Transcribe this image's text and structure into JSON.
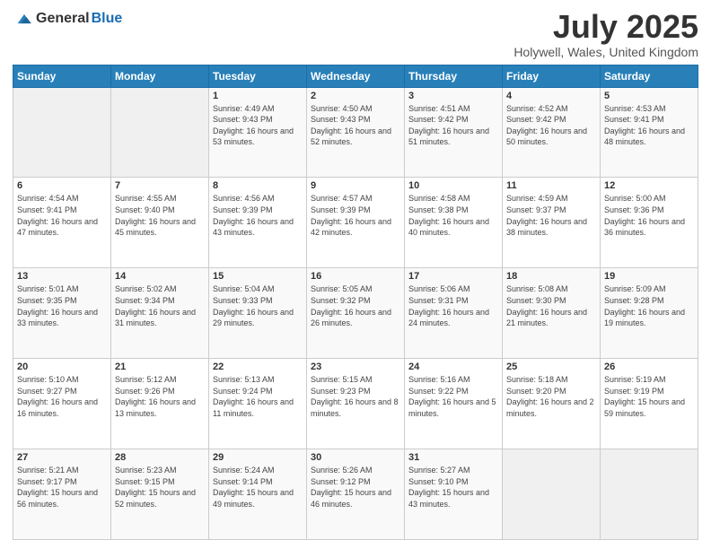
{
  "logo": {
    "general": "General",
    "blue": "Blue"
  },
  "header": {
    "month": "July 2025",
    "location": "Holywell, Wales, United Kingdom"
  },
  "days_of_week": [
    "Sunday",
    "Monday",
    "Tuesday",
    "Wednesday",
    "Thursday",
    "Friday",
    "Saturday"
  ],
  "weeks": [
    [
      {
        "day": "",
        "sunrise": "",
        "sunset": "",
        "daylight": ""
      },
      {
        "day": "",
        "sunrise": "",
        "sunset": "",
        "daylight": ""
      },
      {
        "day": "1",
        "sunrise": "Sunrise: 4:49 AM",
        "sunset": "Sunset: 9:43 PM",
        "daylight": "Daylight: 16 hours and 53 minutes."
      },
      {
        "day": "2",
        "sunrise": "Sunrise: 4:50 AM",
        "sunset": "Sunset: 9:43 PM",
        "daylight": "Daylight: 16 hours and 52 minutes."
      },
      {
        "day": "3",
        "sunrise": "Sunrise: 4:51 AM",
        "sunset": "Sunset: 9:42 PM",
        "daylight": "Daylight: 16 hours and 51 minutes."
      },
      {
        "day": "4",
        "sunrise": "Sunrise: 4:52 AM",
        "sunset": "Sunset: 9:42 PM",
        "daylight": "Daylight: 16 hours and 50 minutes."
      },
      {
        "day": "5",
        "sunrise": "Sunrise: 4:53 AM",
        "sunset": "Sunset: 9:41 PM",
        "daylight": "Daylight: 16 hours and 48 minutes."
      }
    ],
    [
      {
        "day": "6",
        "sunrise": "Sunrise: 4:54 AM",
        "sunset": "Sunset: 9:41 PM",
        "daylight": "Daylight: 16 hours and 47 minutes."
      },
      {
        "day": "7",
        "sunrise": "Sunrise: 4:55 AM",
        "sunset": "Sunset: 9:40 PM",
        "daylight": "Daylight: 16 hours and 45 minutes."
      },
      {
        "day": "8",
        "sunrise": "Sunrise: 4:56 AM",
        "sunset": "Sunset: 9:39 PM",
        "daylight": "Daylight: 16 hours and 43 minutes."
      },
      {
        "day": "9",
        "sunrise": "Sunrise: 4:57 AM",
        "sunset": "Sunset: 9:39 PM",
        "daylight": "Daylight: 16 hours and 42 minutes."
      },
      {
        "day": "10",
        "sunrise": "Sunrise: 4:58 AM",
        "sunset": "Sunset: 9:38 PM",
        "daylight": "Daylight: 16 hours and 40 minutes."
      },
      {
        "day": "11",
        "sunrise": "Sunrise: 4:59 AM",
        "sunset": "Sunset: 9:37 PM",
        "daylight": "Daylight: 16 hours and 38 minutes."
      },
      {
        "day": "12",
        "sunrise": "Sunrise: 5:00 AM",
        "sunset": "Sunset: 9:36 PM",
        "daylight": "Daylight: 16 hours and 36 minutes."
      }
    ],
    [
      {
        "day": "13",
        "sunrise": "Sunrise: 5:01 AM",
        "sunset": "Sunset: 9:35 PM",
        "daylight": "Daylight: 16 hours and 33 minutes."
      },
      {
        "day": "14",
        "sunrise": "Sunrise: 5:02 AM",
        "sunset": "Sunset: 9:34 PM",
        "daylight": "Daylight: 16 hours and 31 minutes."
      },
      {
        "day": "15",
        "sunrise": "Sunrise: 5:04 AM",
        "sunset": "Sunset: 9:33 PM",
        "daylight": "Daylight: 16 hours and 29 minutes."
      },
      {
        "day": "16",
        "sunrise": "Sunrise: 5:05 AM",
        "sunset": "Sunset: 9:32 PM",
        "daylight": "Daylight: 16 hours and 26 minutes."
      },
      {
        "day": "17",
        "sunrise": "Sunrise: 5:06 AM",
        "sunset": "Sunset: 9:31 PM",
        "daylight": "Daylight: 16 hours and 24 minutes."
      },
      {
        "day": "18",
        "sunrise": "Sunrise: 5:08 AM",
        "sunset": "Sunset: 9:30 PM",
        "daylight": "Daylight: 16 hours and 21 minutes."
      },
      {
        "day": "19",
        "sunrise": "Sunrise: 5:09 AM",
        "sunset": "Sunset: 9:28 PM",
        "daylight": "Daylight: 16 hours and 19 minutes."
      }
    ],
    [
      {
        "day": "20",
        "sunrise": "Sunrise: 5:10 AM",
        "sunset": "Sunset: 9:27 PM",
        "daylight": "Daylight: 16 hours and 16 minutes."
      },
      {
        "day": "21",
        "sunrise": "Sunrise: 5:12 AM",
        "sunset": "Sunset: 9:26 PM",
        "daylight": "Daylight: 16 hours and 13 minutes."
      },
      {
        "day": "22",
        "sunrise": "Sunrise: 5:13 AM",
        "sunset": "Sunset: 9:24 PM",
        "daylight": "Daylight: 16 hours and 11 minutes."
      },
      {
        "day": "23",
        "sunrise": "Sunrise: 5:15 AM",
        "sunset": "Sunset: 9:23 PM",
        "daylight": "Daylight: 16 hours and 8 minutes."
      },
      {
        "day": "24",
        "sunrise": "Sunrise: 5:16 AM",
        "sunset": "Sunset: 9:22 PM",
        "daylight": "Daylight: 16 hours and 5 minutes."
      },
      {
        "day": "25",
        "sunrise": "Sunrise: 5:18 AM",
        "sunset": "Sunset: 9:20 PM",
        "daylight": "Daylight: 16 hours and 2 minutes."
      },
      {
        "day": "26",
        "sunrise": "Sunrise: 5:19 AM",
        "sunset": "Sunset: 9:19 PM",
        "daylight": "Daylight: 15 hours and 59 minutes."
      }
    ],
    [
      {
        "day": "27",
        "sunrise": "Sunrise: 5:21 AM",
        "sunset": "Sunset: 9:17 PM",
        "daylight": "Daylight: 15 hours and 56 minutes."
      },
      {
        "day": "28",
        "sunrise": "Sunrise: 5:23 AM",
        "sunset": "Sunset: 9:15 PM",
        "daylight": "Daylight: 15 hours and 52 minutes."
      },
      {
        "day": "29",
        "sunrise": "Sunrise: 5:24 AM",
        "sunset": "Sunset: 9:14 PM",
        "daylight": "Daylight: 15 hours and 49 minutes."
      },
      {
        "day": "30",
        "sunrise": "Sunrise: 5:26 AM",
        "sunset": "Sunset: 9:12 PM",
        "daylight": "Daylight: 15 hours and 46 minutes."
      },
      {
        "day": "31",
        "sunrise": "Sunrise: 5:27 AM",
        "sunset": "Sunset: 9:10 PM",
        "daylight": "Daylight: 15 hours and 43 minutes."
      },
      {
        "day": "",
        "sunrise": "",
        "sunset": "",
        "daylight": ""
      },
      {
        "day": "",
        "sunrise": "",
        "sunset": "",
        "daylight": ""
      }
    ]
  ]
}
